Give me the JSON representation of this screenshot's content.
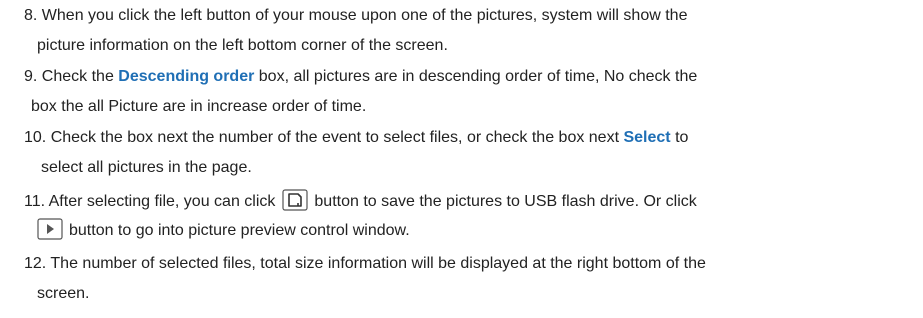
{
  "items": [
    {
      "num": "8.",
      "line1": "When you click the left button of your mouse upon one of the pictures, system will show the",
      "line2": "picture information on the left bottom corner of the screen."
    },
    {
      "num": "9.",
      "line1_a": "Check the",
      "highlight": "Descending order",
      "line1_b": "box, all pictures are in descending order of time, No check the",
      "line2": "box the all Picture are in increase order of time."
    },
    {
      "num": "10.",
      "line1_a": "Check the box next the number of the event to select files, or check the box next",
      "highlight": "Select",
      "line1_b": "to",
      "line2": "select all pictures in the page."
    },
    {
      "num": "11.",
      "line1_a": "After selecting file, you can click",
      "line1_b": "button to save the pictures to USB flash drive. Or click",
      "line2": "button to go into picture preview control window.",
      "icon1": "save-icon",
      "icon2": "play-icon"
    },
    {
      "num": "12.",
      "line1": "The number of selected files, total size information will be displayed at the right bottom of the",
      "line2": "screen."
    }
  ],
  "colors": {
    "text": "#222222",
    "highlight": "#1f6fb5",
    "icon_border": "#555555"
  }
}
